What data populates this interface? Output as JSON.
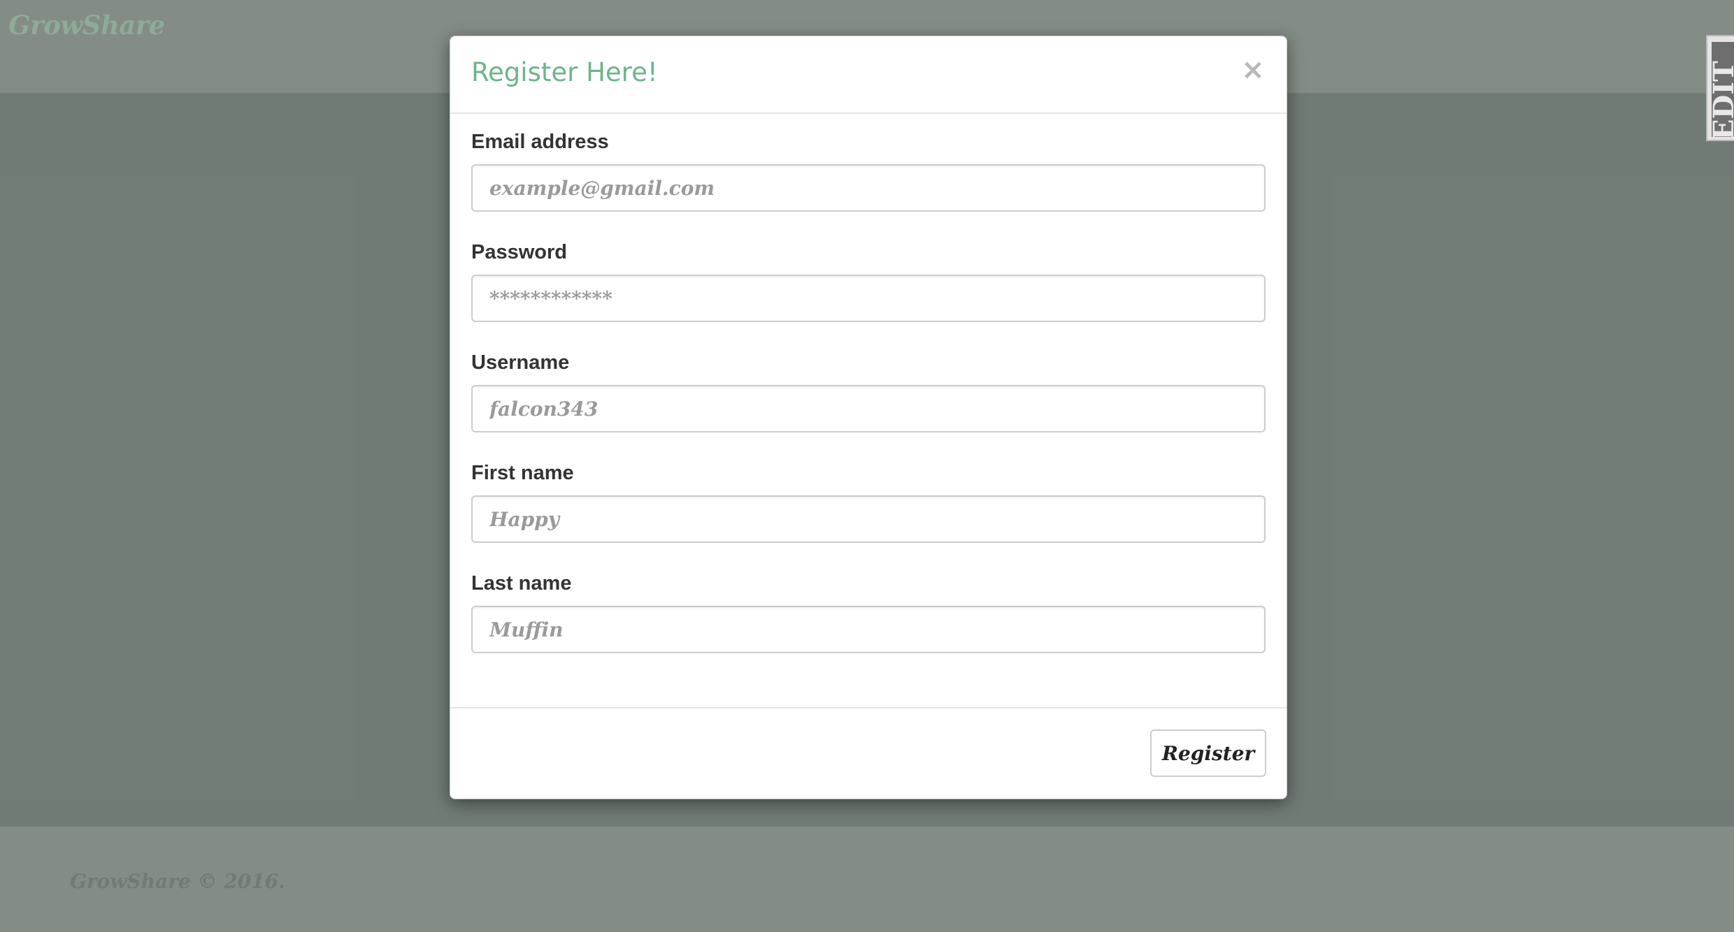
{
  "brand": "GrowShare",
  "footer": {
    "copyright": "GrowShare © 2016."
  },
  "edge_tab": {
    "label": "EDIT"
  },
  "modal": {
    "title": "Register Here!",
    "close_symbol": "×",
    "fields": [
      {
        "label": "Email address",
        "placeholder": "example@gmail.com",
        "type": "email"
      },
      {
        "label": "Password",
        "placeholder": "************",
        "type": "password"
      },
      {
        "label": "Username",
        "placeholder": "falcon343",
        "type": "text"
      },
      {
        "label": "First name",
        "placeholder": "Happy",
        "type": "text"
      },
      {
        "label": "Last name",
        "placeholder": "Muffin",
        "type": "text"
      }
    ],
    "submit_label": "Register"
  },
  "colors": {
    "brand_green": "#3f6f4d",
    "title_green": "#6db589",
    "page_background": "#0a1d12"
  }
}
